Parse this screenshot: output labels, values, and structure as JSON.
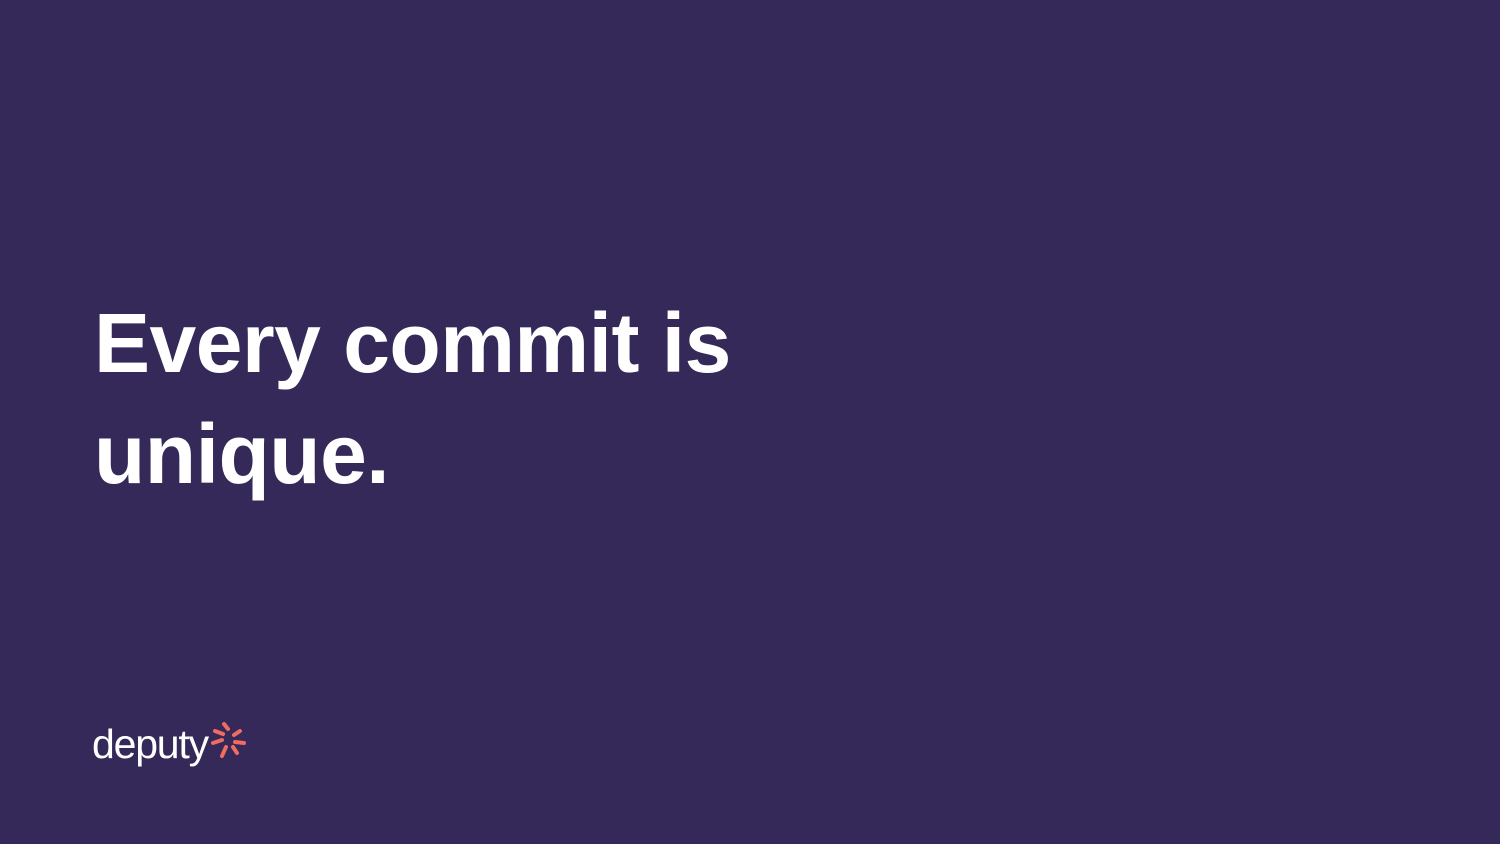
{
  "slide": {
    "headline_lines": [
      "Every commit is",
      "unique."
    ],
    "background_color": "#342959",
    "text_color": "#ffffff"
  },
  "logo": {
    "wordmark": "deputy",
    "mark_icon": "deputy-burst-icon",
    "accent_color": "#f06b62"
  }
}
